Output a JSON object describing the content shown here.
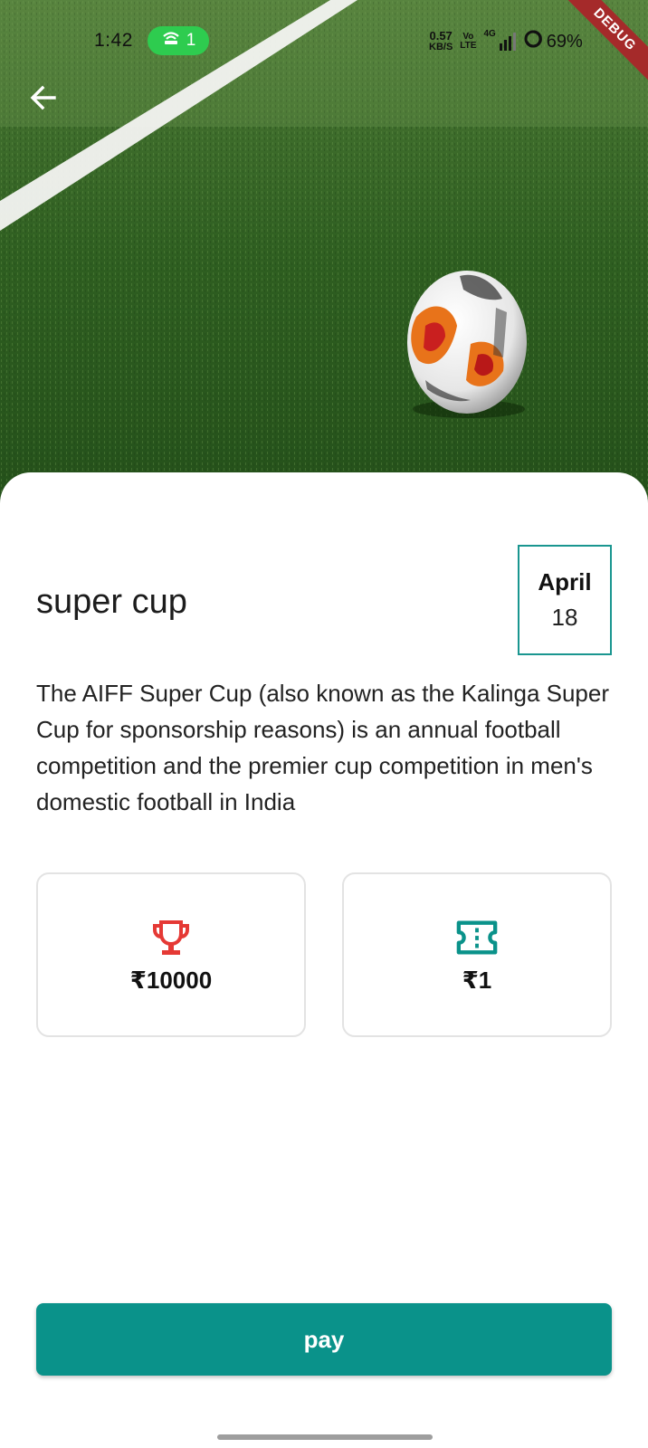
{
  "status_bar": {
    "time": "1:42",
    "hotspot_count": "1",
    "net_speed_value": "0.57",
    "net_speed_unit": "KB/S",
    "volte_top": "Vo",
    "volte_bottom": "LTE",
    "network_type": "4G",
    "battery": "69%"
  },
  "debug_banner": "DEBUG",
  "event": {
    "title": "super cup",
    "date_month": "April",
    "date_day": "18",
    "description": "The AIFF Super Cup (also known as the Kalinga Super Cup for sponsorship reasons) is an annual football competition and the premier cup competition in men's domestic football in India"
  },
  "cards": {
    "prize": {
      "icon": "trophy-icon",
      "value": "₹10000"
    },
    "entry_fee": {
      "icon": "ticket-icon",
      "value": "₹1"
    }
  },
  "actions": {
    "pay_label": "pay"
  },
  "colors": {
    "accent": "#0a928a",
    "trophy": "#e53935",
    "hotspot": "#2ecc4f",
    "debug": "#a52a2a"
  }
}
